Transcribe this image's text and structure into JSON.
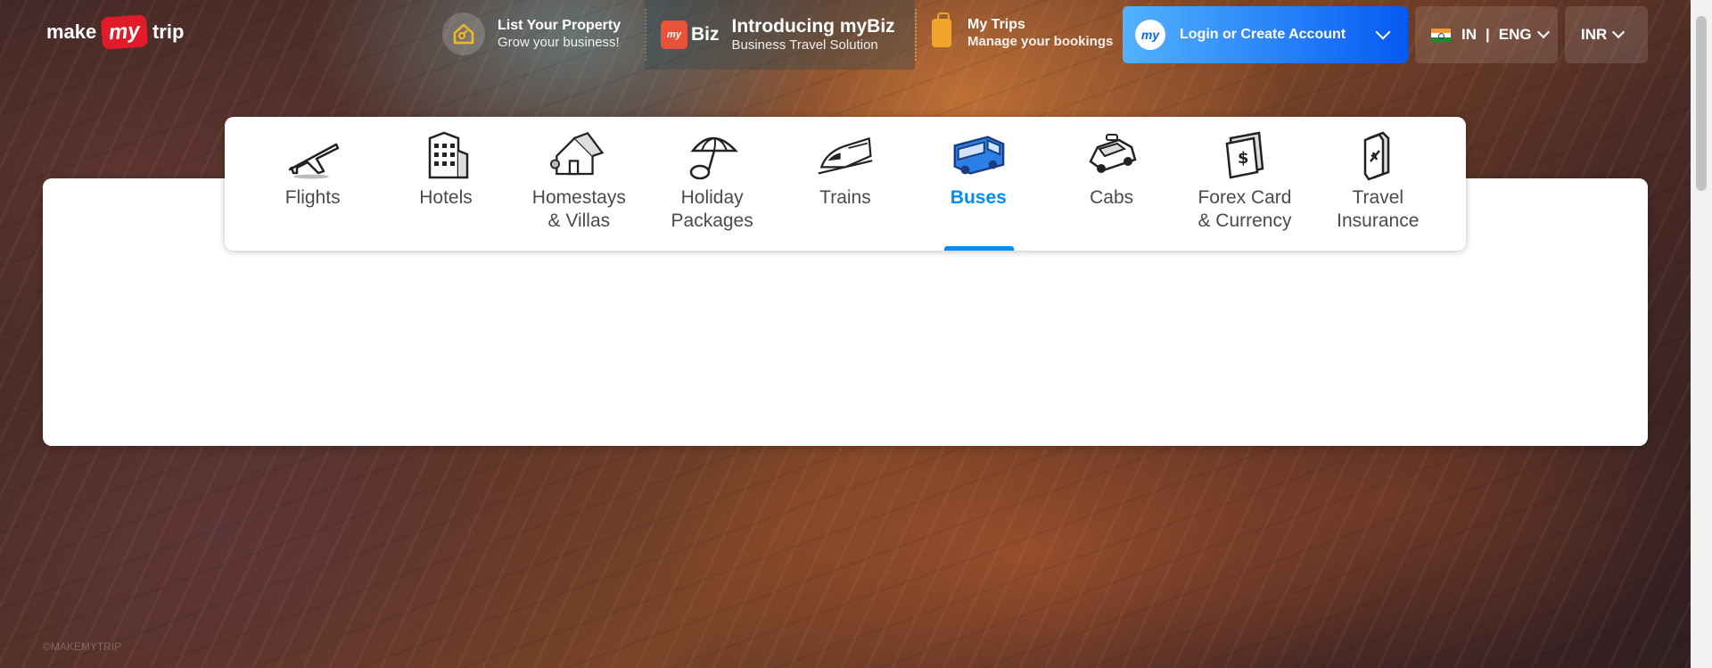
{
  "brand": {
    "make": "make",
    "my": "my",
    "trip": "trip"
  },
  "header": {
    "list_property": {
      "title": "List Your Property",
      "subtitle": "Grow your business!"
    },
    "mybiz": {
      "badge": "my",
      "word": "Biz",
      "title": "Introducing myBiz",
      "subtitle": "Business Travel Solution"
    },
    "my_trips": {
      "title": "My Trips",
      "subtitle": "Manage your bookings"
    },
    "login": {
      "avatar": "my",
      "label": "Login or Create Account"
    },
    "language": {
      "country": "IN",
      "separator": "|",
      "lang": "ENG"
    },
    "currency": {
      "code": "INR"
    }
  },
  "nav": {
    "active": "Buses",
    "items": [
      {
        "label": "Flights",
        "icon": "plane-icon"
      },
      {
        "label": "Hotels",
        "icon": "hotel-icon"
      },
      {
        "label": "Homestays\n& Villas",
        "icon": "homestay-icon"
      },
      {
        "label": "Holiday\nPackages",
        "icon": "umbrella-icon"
      },
      {
        "label": "Trains",
        "icon": "train-icon"
      },
      {
        "label": "Buses",
        "icon": "bus-icon"
      },
      {
        "label": "Cabs",
        "icon": "cab-icon"
      },
      {
        "label": "Forex Card\n& Currency",
        "icon": "forex-icon"
      },
      {
        "label": "Travel\nInsurance",
        "icon": "insurance-icon"
      }
    ]
  },
  "watermark": "©MAKEMYTRIP",
  "colors": {
    "accent": "#008cff",
    "brand_red": "#e21b2a",
    "login_start": "#53b2fe",
    "login_end": "#065af3"
  }
}
